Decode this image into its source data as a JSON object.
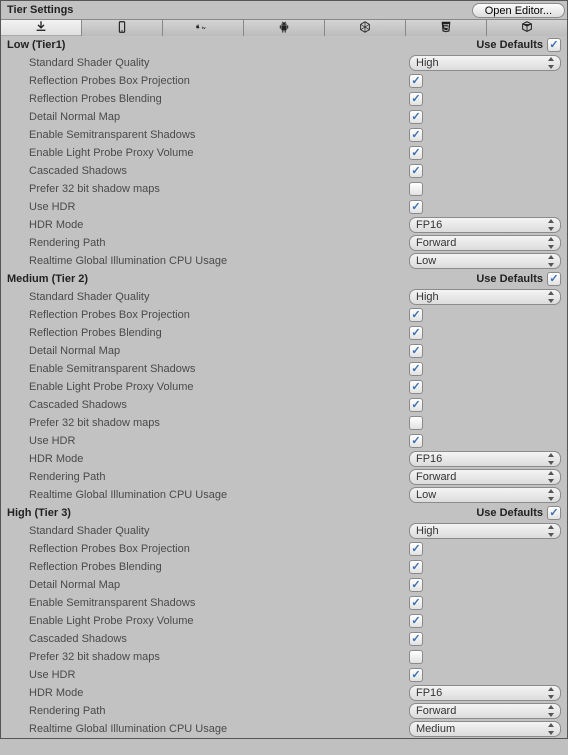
{
  "header": {
    "title": "Tier Settings",
    "open_editor": "Open Editor..."
  },
  "tabs": [
    {
      "name": "download"
    },
    {
      "name": "phone"
    },
    {
      "name": "appletv"
    },
    {
      "name": "android"
    },
    {
      "name": "unity"
    },
    {
      "name": "html5"
    },
    {
      "name": "cube"
    }
  ],
  "common_labels": {
    "use_defaults": "Use Defaults",
    "shader_quality": "Standard Shader Quality",
    "refl_box": "Reflection Probes Box Projection",
    "refl_blend": "Reflection Probes Blending",
    "detail_normal": "Detail Normal Map",
    "semi_shadows": "Enable Semitransparent Shadows",
    "light_probe": "Enable Light Probe Proxy Volume",
    "cascaded": "Cascaded Shadows",
    "prefer32": "Prefer 32 bit shadow maps",
    "use_hdr": "Use HDR",
    "hdr_mode": "HDR Mode",
    "render_path": "Rendering Path",
    "gi_cpu": "Realtime Global Illumination CPU Usage"
  },
  "tiers": [
    {
      "title": "Low (Tier1)",
      "use_defaults": true,
      "shader_quality": "High",
      "refl_box": true,
      "refl_blend": true,
      "detail_normal": true,
      "semi_shadows": true,
      "light_probe": true,
      "cascaded": true,
      "prefer32": false,
      "use_hdr": true,
      "hdr_mode": "FP16",
      "render_path": "Forward",
      "gi_cpu": "Low"
    },
    {
      "title": "Medium (Tier 2)",
      "use_defaults": true,
      "shader_quality": "High",
      "refl_box": true,
      "refl_blend": true,
      "detail_normal": true,
      "semi_shadows": true,
      "light_probe": true,
      "cascaded": true,
      "prefer32": false,
      "use_hdr": true,
      "hdr_mode": "FP16",
      "render_path": "Forward",
      "gi_cpu": "Low"
    },
    {
      "title": "High (Tier 3)",
      "use_defaults": true,
      "shader_quality": "High",
      "refl_box": true,
      "refl_blend": true,
      "detail_normal": true,
      "semi_shadows": true,
      "light_probe": true,
      "cascaded": true,
      "prefer32": false,
      "use_hdr": true,
      "hdr_mode": "FP16",
      "render_path": "Forward",
      "gi_cpu": "Medium"
    }
  ]
}
